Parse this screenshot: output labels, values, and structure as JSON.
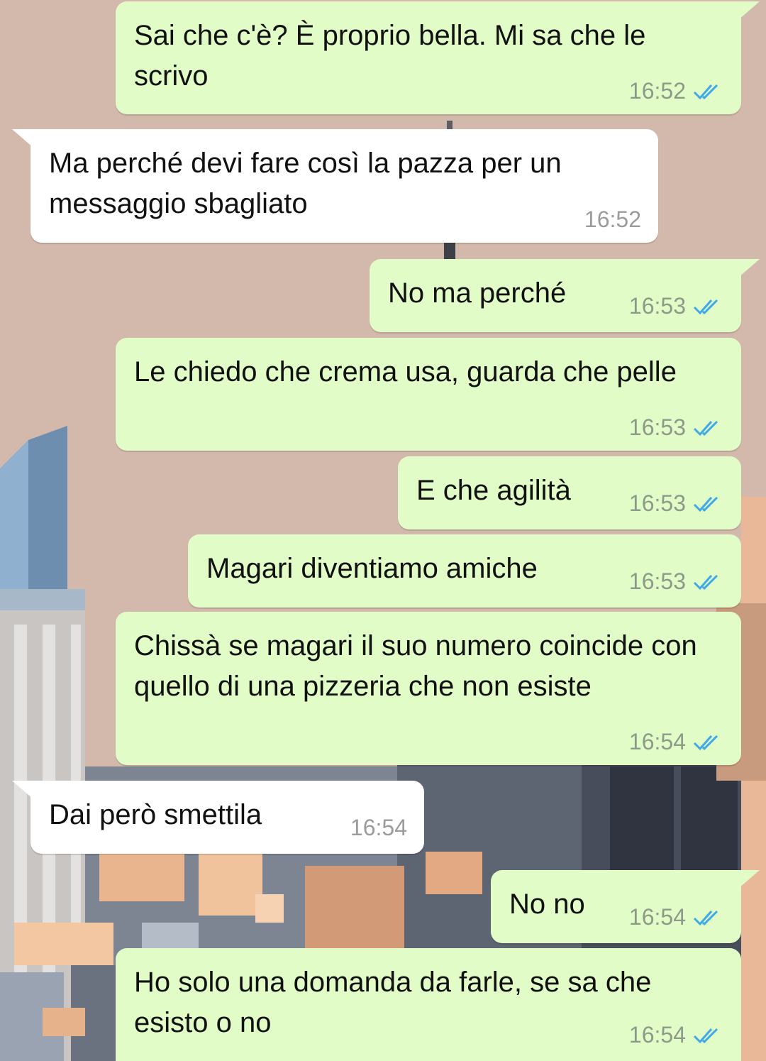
{
  "colors": {
    "wallpaper": "#d3b8ac",
    "outgoing_bubble": "#e1fcc7",
    "incoming_bubble": "#ffffff",
    "read_ticks": "#3fa8e8",
    "timestamp": "#8e9a89"
  },
  "messages": [
    {
      "direction": "outgoing",
      "text": "Sai che c'è? È proprio bella. Mi sa che le scrivo",
      "time": "16:52",
      "status": "read",
      "status_icon": "double-check-icon"
    },
    {
      "direction": "incoming",
      "text": "Ma perché devi fare così la pazza per un messaggio sbagliato",
      "time": "16:52"
    },
    {
      "direction": "outgoing",
      "text": "No ma perché",
      "time": "16:53",
      "status": "read",
      "status_icon": "double-check-icon"
    },
    {
      "direction": "outgoing",
      "text": "Le chiedo che crema usa, guarda che pelle",
      "time": "16:53",
      "status": "read",
      "status_icon": "double-check-icon"
    },
    {
      "direction": "outgoing",
      "text": "E che agilità",
      "time": "16:53",
      "status": "read",
      "status_icon": "double-check-icon"
    },
    {
      "direction": "outgoing",
      "text": "Magari diventiamo amiche",
      "time": "16:53",
      "status": "read",
      "status_icon": "double-check-icon"
    },
    {
      "direction": "outgoing",
      "text": "Chissà se magari il suo numero coincide con quello di una pizzeria che non esiste",
      "time": "16:54",
      "status": "read",
      "status_icon": "double-check-icon"
    },
    {
      "direction": "incoming",
      "text": "Dai però smettila",
      "time": "16:54"
    },
    {
      "direction": "outgoing",
      "text": "No no",
      "time": "16:54",
      "status": "read",
      "status_icon": "double-check-icon"
    },
    {
      "direction": "outgoing",
      "text": "Ho solo una domanda da farle, se sa che esisto o no",
      "time": "16:54",
      "status": "read",
      "status_icon": "double-check-icon"
    }
  ]
}
